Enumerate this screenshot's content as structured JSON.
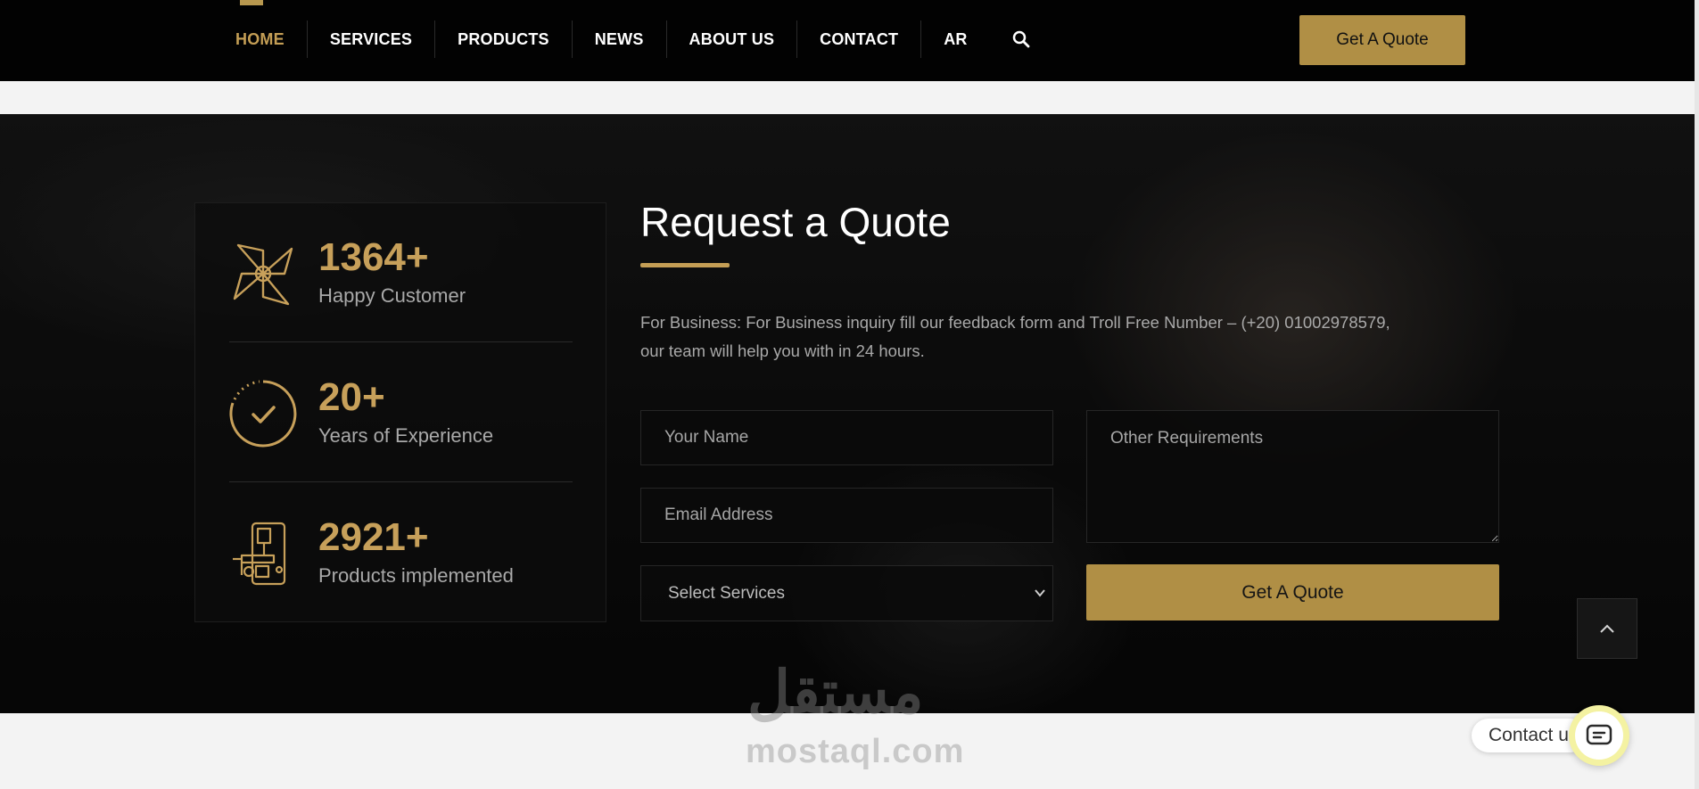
{
  "nav": {
    "items": [
      {
        "label": "HOME",
        "active": true
      },
      {
        "label": "SERVICES"
      },
      {
        "label": "PRODUCTS"
      },
      {
        "label": "NEWS"
      },
      {
        "label": "ABOUT US"
      },
      {
        "label": "CONTACT"
      },
      {
        "label": "AR"
      }
    ],
    "search_icon": "search-icon",
    "cta_label": "Get A Quote"
  },
  "stats": [
    {
      "icon": "pinwheel-icon",
      "value": "1364+",
      "label": "Happy Customer"
    },
    {
      "icon": "check-circle-icon",
      "value": "20+",
      "label": "Years of Experience"
    },
    {
      "icon": "machine-icon",
      "value": "2921+",
      "label": "Products implemented"
    }
  ],
  "quote": {
    "title": "Request a Quote",
    "description": "For Business: For Business inquiry fill our feedback form and Troll Free Number – (+20) 01002978579, our team will help you with in 24 hours.",
    "name_placeholder": "Your Name",
    "email_placeholder": "Email Address",
    "service_selected": "Select Services",
    "requirements_placeholder": "Other Requirements",
    "submit_label": "Get A Quote"
  },
  "watermark": {
    "arabic": "مستقل",
    "latin": "mostaql.com"
  },
  "contact_widget": {
    "label": "Contact us"
  },
  "colors": {
    "accent": "#c49e55",
    "button": "#b08f45",
    "background": "#020202"
  }
}
